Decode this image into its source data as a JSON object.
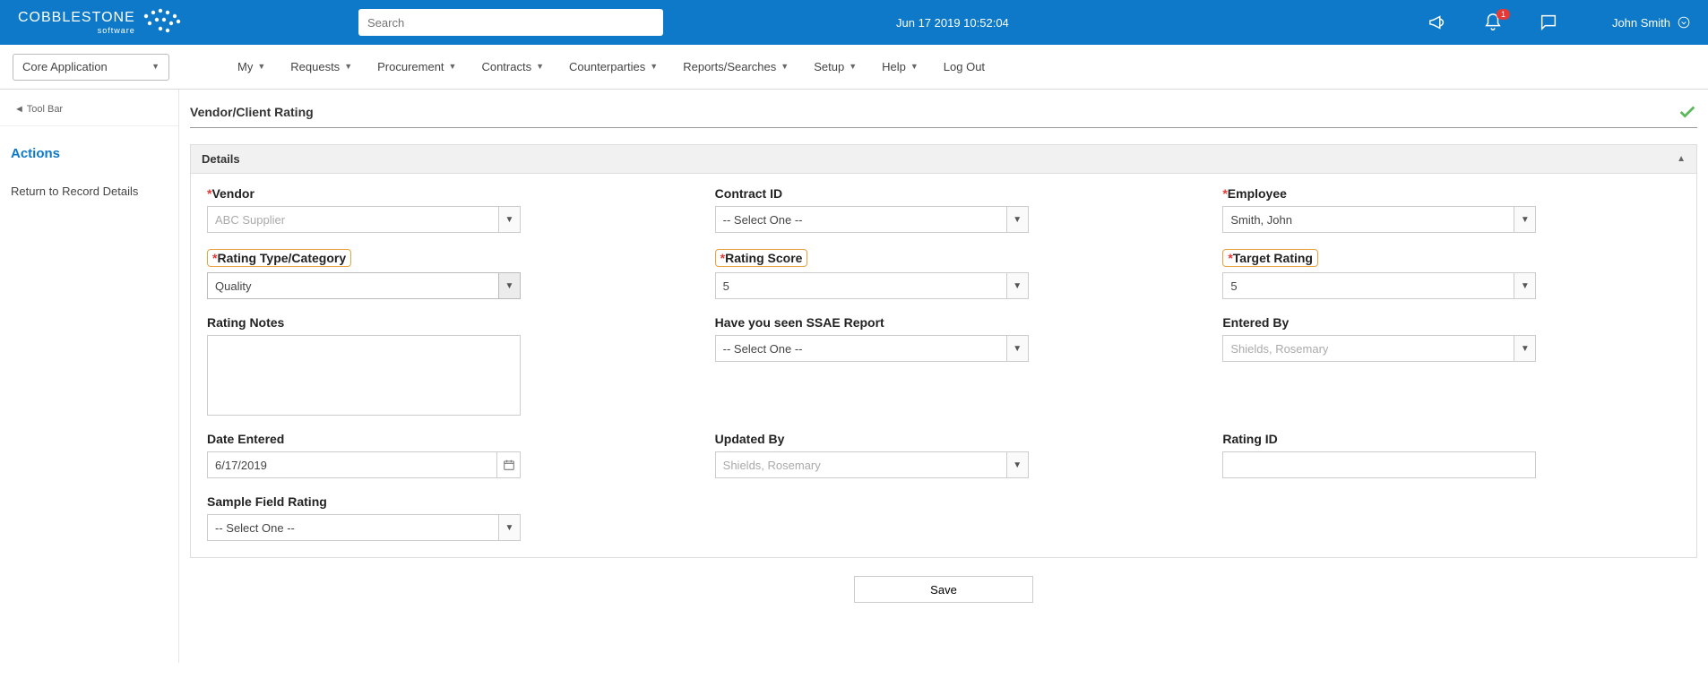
{
  "header": {
    "logo_main": "COBBLESTONE",
    "logo_sub": "software",
    "search_placeholder": "Search",
    "datetime": "Jun 17 2019 10:52:04",
    "notification_count": "1",
    "username": "John Smith"
  },
  "nav": {
    "core": "Core Application",
    "items": [
      "My",
      "Requests",
      "Procurement",
      "Contracts",
      "Counterparties",
      "Reports/Searches",
      "Setup",
      "Help"
    ],
    "logout": "Log Out"
  },
  "sidebar": {
    "toolbar": "◄ Tool Bar",
    "actions": "Actions",
    "return": "Return to Record Details"
  },
  "page": {
    "title": "Vendor/Client Rating",
    "panel_title": "Details",
    "save": "Save"
  },
  "fields": {
    "vendor": {
      "label": "Vendor",
      "value": "ABC Supplier"
    },
    "contract_id": {
      "label": "Contract ID",
      "value": "-- Select One --"
    },
    "employee": {
      "label": "Employee",
      "value": "Smith, John"
    },
    "rating_type": {
      "label": "Rating Type/Category",
      "value": "Quality"
    },
    "rating_score": {
      "label": "Rating Score",
      "value": "5"
    },
    "target_rating": {
      "label": "Target Rating",
      "value": "5"
    },
    "rating_notes": {
      "label": "Rating Notes",
      "value": ""
    },
    "ssae": {
      "label": "Have you seen SSAE Report",
      "value": "-- Select One --"
    },
    "entered_by": {
      "label": "Entered By",
      "value": "Shields, Rosemary"
    },
    "date_entered": {
      "label": "Date Entered",
      "value": "6/17/2019"
    },
    "updated_by": {
      "label": "Updated By",
      "value": "Shields, Rosemary"
    },
    "rating_id": {
      "label": "Rating ID",
      "value": ""
    },
    "sample": {
      "label": "Sample Field Rating",
      "value": "-- Select One --"
    }
  }
}
